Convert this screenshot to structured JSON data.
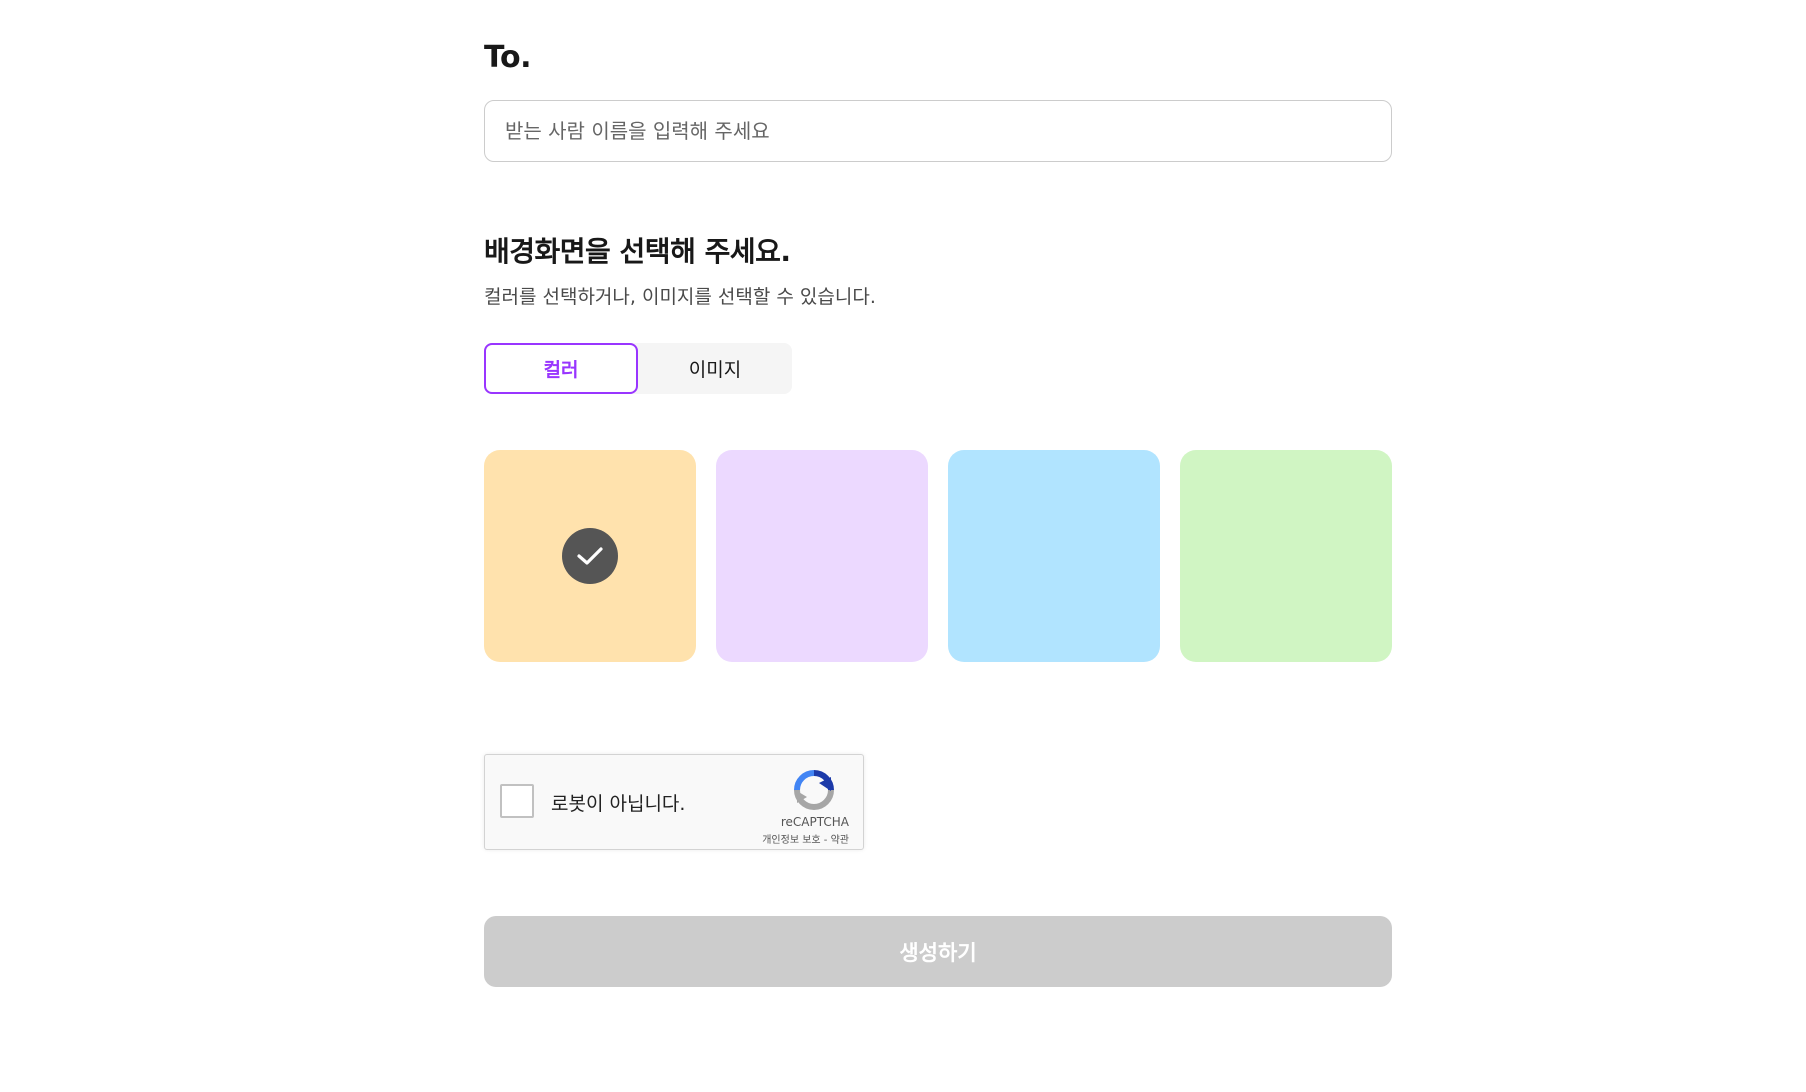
{
  "recipient": {
    "title": "To.",
    "placeholder": "받는 사람 이름을 입력해 주세요",
    "value": ""
  },
  "background": {
    "title": "배경화면을 선택해 주세요.",
    "description": "컬러를 선택하거나, 이미지를 선택할 수 있습니다.",
    "tabs": [
      {
        "label": "컬러",
        "active": true
      },
      {
        "label": "이미지",
        "active": false
      }
    ],
    "accent_color": "#9935ff",
    "swatches": [
      {
        "name": "beige",
        "color": "#ffe2ad",
        "selected": true
      },
      {
        "name": "purple",
        "color": "#ecd9ff",
        "selected": false
      },
      {
        "name": "blue",
        "color": "#b1e4ff",
        "selected": false
      },
      {
        "name": "green",
        "color": "#d0f5c3",
        "selected": false
      }
    ]
  },
  "captcha": {
    "label": "로봇이 아닙니다.",
    "brand": "reCAPTCHA",
    "privacy": "개인정보 보호",
    "separator": " - ",
    "terms": "약관"
  },
  "submit": {
    "label": "생성하기",
    "enabled": false
  }
}
